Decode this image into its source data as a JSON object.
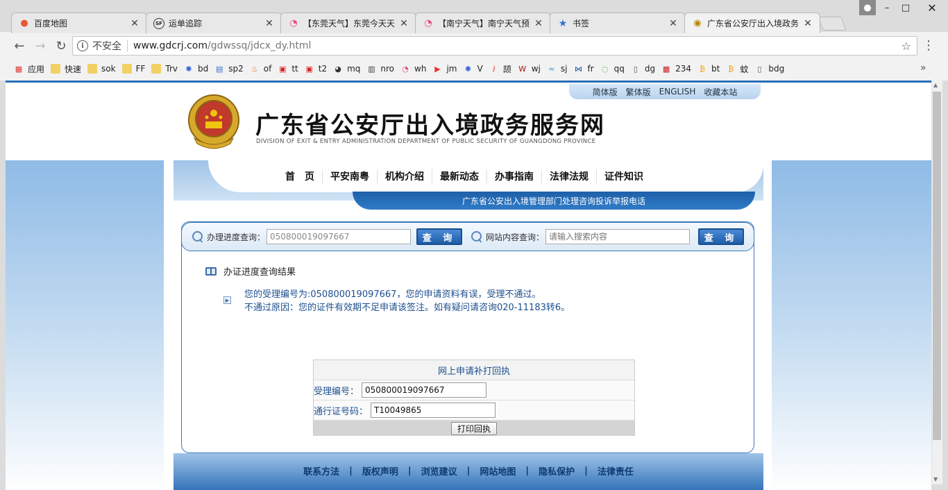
{
  "browser": {
    "tabs": [
      {
        "title": "百度地图",
        "icon": "map-pin-icon"
      },
      {
        "title": "运单追踪",
        "icon": "sf-icon"
      },
      {
        "title": "【东莞天气】东莞今天天",
        "icon": "weather-icon"
      },
      {
        "title": "【南宁天气】南宁天气预",
        "icon": "weather-icon"
      },
      {
        "title": "书签",
        "icon": "star-icon"
      },
      {
        "title": "广东省公安厅出入境政务",
        "icon": "police-emblem-icon"
      }
    ],
    "window_buttons": {
      "min": "–",
      "max": "□",
      "close": "✕"
    },
    "address": {
      "security_label": "不安全",
      "host": "www.gdcrj.com",
      "path": "/gdwssq/jdcx_dy.html"
    },
    "bookmarks": [
      {
        "label": "应用",
        "icon": "apps-grid-icon"
      },
      {
        "label": "快速",
        "icon": "folder-icon"
      },
      {
        "label": "sok",
        "icon": "folder-icon"
      },
      {
        "label": "FF",
        "icon": "folder-icon"
      },
      {
        "label": "Trv",
        "icon": "folder-icon"
      },
      {
        "label": "bd",
        "icon": "baidu-paw-icon"
      },
      {
        "label": "sp2",
        "icon": "sp-icon"
      },
      {
        "label": "of",
        "icon": "flame-icon"
      },
      {
        "label": "tt",
        "icon": "news-icon"
      },
      {
        "label": "t2",
        "icon": "news-icon"
      },
      {
        "label": "mq",
        "icon": "globe-icon"
      },
      {
        "label": "nro",
        "icon": "tv-icon"
      },
      {
        "label": "wh",
        "icon": "weather-icon"
      },
      {
        "label": "jm",
        "icon": "video-icon"
      },
      {
        "label": "V",
        "icon": "baidu-paw-icon"
      },
      {
        "label": "颉",
        "icon": "dict-icon"
      },
      {
        "label": "wj",
        "icon": "w-icon"
      },
      {
        "label": "sj",
        "icon": "sea-icon"
      },
      {
        "label": "fr",
        "icon": "butterfly-icon"
      },
      {
        "label": "qq",
        "icon": "ring-icon"
      },
      {
        "label": "dg",
        "icon": "page-icon"
      },
      {
        "label": "234",
        "icon": "checker-icon"
      },
      {
        "label": "bt",
        "icon": "bitcoin-icon"
      },
      {
        "label": "蚊",
        "icon": "bitcoin-square-icon"
      },
      {
        "label": "bdg",
        "icon": "page-icon"
      }
    ],
    "bookmarks_more": "»"
  },
  "site": {
    "top_links": [
      "简体版",
      "繁体版",
      "ENGLISH",
      "收藏本站"
    ],
    "title": "广东省公安厅出入境政务服务网",
    "subtitle": "DIVISION OF EXIT & ENTRY ADMINISTRATION DEPARTMENT OF PUBLIC SECURITY OF GUANGDONG PROVINCE",
    "nav": [
      "首　页",
      "平安南粤",
      "机构介绍",
      "最新动态",
      "办事指南",
      "法律法规",
      "证件知识"
    ],
    "hotline": "广东省公安出入境管理部门处理咨询投诉举报电话"
  },
  "search": {
    "progress_label": "办理进度查询：",
    "progress_value": "050800019097667",
    "query_button": "查 询",
    "site_label": "网站内容查询：",
    "site_placeholder": "请输入搜索内容",
    "site_button": "查 询"
  },
  "result": {
    "heading": "办证进度查询结果",
    "line1": "您的受理编号为:050800019097667，您的申请资料有误，受理不通过。",
    "line2": "不通过原因：您的证件有效期不足申请该签注。如有疑问请咨询020-11183转6。"
  },
  "reprint": {
    "title": "网上申请补打回执",
    "accept_label": "受理编号：",
    "accept_value": "050800019097667",
    "permit_label": "通行证号码：",
    "permit_value": "T10049865",
    "print_button": "打印回执"
  },
  "footer": {
    "links": [
      "联系方法",
      "版权声明",
      "浏览建议",
      "网站地图",
      "隐私保护",
      "法律责任"
    ],
    "separator": "|"
  }
}
